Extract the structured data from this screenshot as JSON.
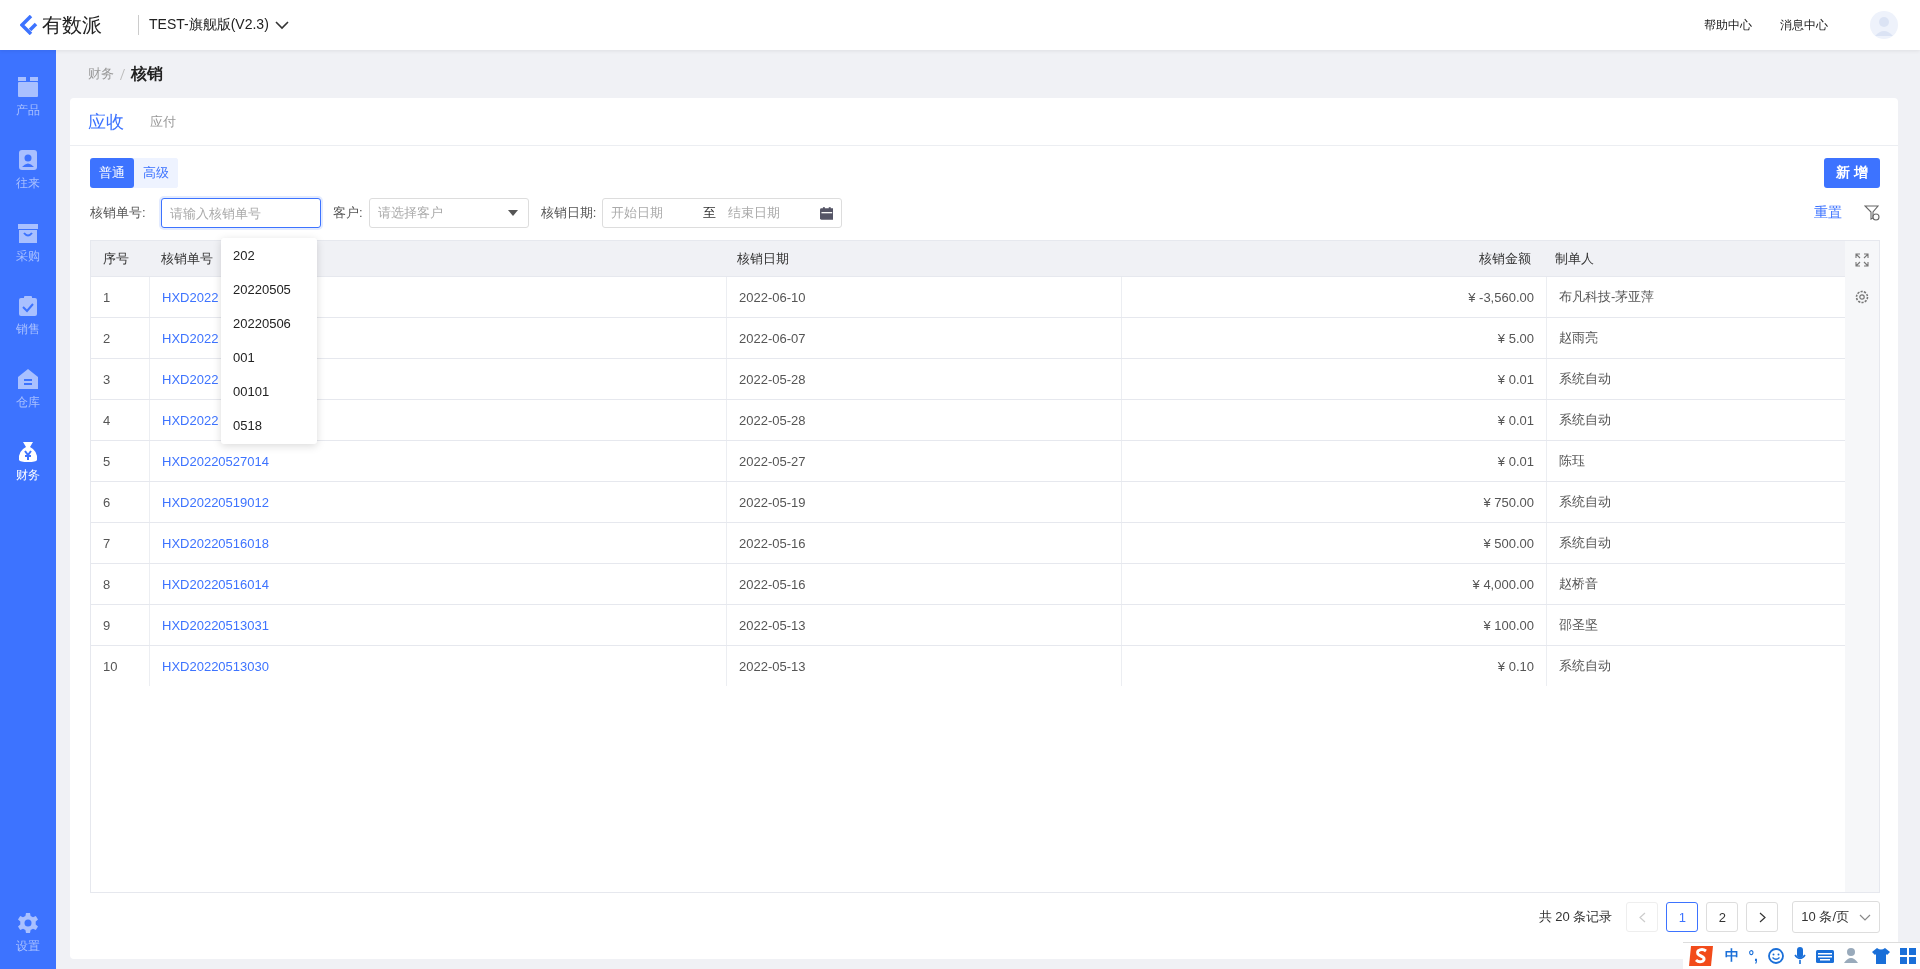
{
  "header": {
    "logo": "有数派",
    "workspace": "TEST-旗舰版(V2.3)",
    "links": [
      "帮助中心",
      "消息中心"
    ]
  },
  "sidebar": {
    "items": [
      {
        "label": "产品",
        "kind": "box",
        "selected": false
      },
      {
        "label": "往来",
        "kind": "contact",
        "selected": false
      },
      {
        "label": "采购",
        "kind": "basket",
        "selected": false
      },
      {
        "label": "销售",
        "kind": "clipboard",
        "selected": false
      },
      {
        "label": "仓库",
        "kind": "warehouse",
        "selected": false
      },
      {
        "label": "财务",
        "kind": "moneybag",
        "selected": true
      }
    ],
    "bottom": {
      "label": "设置",
      "kind": "gear",
      "selected": false
    }
  },
  "breadcrumb": {
    "parent": "财务",
    "current": "核销"
  },
  "tabs": [
    {
      "label": "应收",
      "selected": true
    },
    {
      "label": "应付",
      "selected": false
    }
  ],
  "modes": [
    {
      "label": "普通",
      "selected": true
    },
    {
      "label": "高级",
      "selected": false
    }
  ],
  "new_button": "新 增",
  "filters": {
    "number": {
      "label": "核销单号:",
      "placeholder": "请输入核销单号"
    },
    "customer": {
      "label": "客户:",
      "placeholder": "请选择客户"
    },
    "date": {
      "label": "核销日期:",
      "start_placeholder": "开始日期",
      "separator": "至",
      "end_placeholder": "结束日期"
    },
    "reset": "重置"
  },
  "suggestions": [
    "202",
    "20220505",
    "20220506",
    "001",
    "00101",
    "0518"
  ],
  "table": {
    "columns": [
      "序号",
      "核销单号",
      "核销日期",
      "核销金额",
      "制单人"
    ],
    "rows": [
      [
        "1",
        "HXD2022",
        "2022-06-10",
        "¥ -3,560.00",
        "布凡科技-茅亚萍"
      ],
      [
        "2",
        "HXD2022",
        "2022-06-07",
        "¥ 5.00",
        "赵雨亮"
      ],
      [
        "3",
        "HXD2022",
        "2022-05-28",
        "¥ 0.01",
        "系统自动"
      ],
      [
        "4",
        "HXD2022",
        "2022-05-28",
        "¥ 0.01",
        "系统自动"
      ],
      [
        "5",
        "HXD20220527014",
        "2022-05-27",
        "¥ 0.01",
        "陈珏"
      ],
      [
        "6",
        "HXD20220519012",
        "2022-05-19",
        "¥ 750.00",
        "系统自动"
      ],
      [
        "7",
        "HXD20220516018",
        "2022-05-16",
        "¥ 500.00",
        "系统自动"
      ],
      [
        "8",
        "HXD20220516014",
        "2022-05-16",
        "¥ 4,000.00",
        "赵桥音"
      ],
      [
        "9",
        "HXD20220513031",
        "2022-05-13",
        "¥ 100.00",
        "邵圣坚"
      ],
      [
        "10",
        "HXD20220513030",
        "2022-05-13",
        "¥ 0.10",
        "系统自动"
      ]
    ]
  },
  "pagination": {
    "total": "共 20 条记录",
    "pages": [
      {
        "label": "1",
        "selected": true
      },
      {
        "label": "2",
        "selected": false
      }
    ],
    "page_size": "10 条/页"
  },
  "ime": {
    "mode": "中",
    "punct": "°,"
  }
}
